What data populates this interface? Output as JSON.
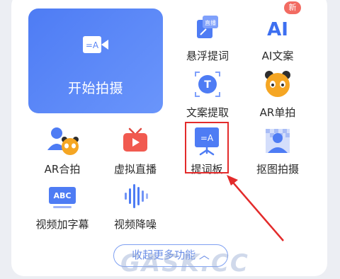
{
  "hero": {
    "label": "开始拍摄",
    "icon": "teleprompter-icon"
  },
  "tools": [
    {
      "label": "悬浮提词",
      "icon": "floating-prompt-icon",
      "icon_text": "直播"
    },
    {
      "label": "AI文案",
      "icon": "ai-copy-icon",
      "badge": "新",
      "icon_text": "AI"
    },
    {
      "label": "文案提取",
      "icon": "text-extract-icon",
      "icon_text": "T"
    },
    {
      "label": "AR单拍",
      "icon": "ar-panda-icon"
    },
    {
      "label": "AR合拍",
      "icon": "ar-duet-icon"
    },
    {
      "label": "虚拟直播",
      "icon": "virtual-live-icon"
    },
    {
      "label": "提词板",
      "icon": "teleprompter-board-icon"
    },
    {
      "label": "抠图拍摄",
      "icon": "cutout-shoot-icon"
    },
    {
      "label": "视频加字幕",
      "icon": "video-subtitle-icon",
      "icon_text": "ABC"
    },
    {
      "label": "视频降噪",
      "icon": "video-denoise-icon"
    }
  ],
  "collapse_label": "收起更多功能",
  "watermark": "GASK.CC",
  "colors": {
    "accent": "#4e7cf4",
    "highlight": "#e32b2b",
    "badge": "#f26b62"
  }
}
